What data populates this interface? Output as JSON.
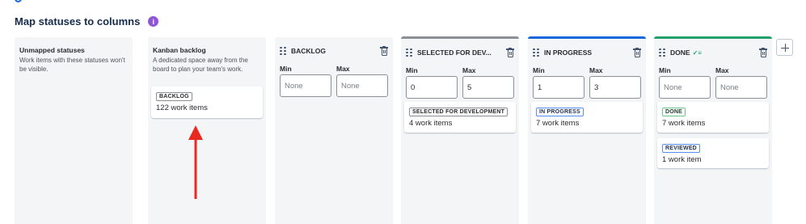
{
  "heading": {
    "title": "Map statuses to columns",
    "info_icon_glyph": "i"
  },
  "unmapped": {
    "title": "Unmapped statuses",
    "description": "Work items with these statuses won't be visible."
  },
  "kanban_backlog": {
    "title": "Kanban backlog",
    "description": "A dedicated space away from the board to plan your team's work.",
    "card": {
      "status": "BACKLOG",
      "count": "122 work items"
    }
  },
  "columns": [
    {
      "name": "BACKLOG",
      "min_label": "Min",
      "max_label": "Max",
      "min_value": "",
      "max_value": "",
      "min_placeholder": "None",
      "max_placeholder": "None",
      "cards": []
    },
    {
      "name": "SELECTED FOR DEV...",
      "accent": "#8c8f97",
      "min_label": "Min",
      "max_label": "Max",
      "min_value": "0",
      "max_value": "5",
      "min_placeholder": "None",
      "max_placeholder": "None",
      "cards": [
        {
          "status": "SELECTED FOR DEVELOPMENT",
          "count": "4 work items"
        }
      ]
    },
    {
      "name": "IN PROGRESS",
      "accent": "#1868db",
      "min_label": "Min",
      "max_label": "Max",
      "min_value": "1",
      "max_value": "3",
      "min_placeholder": "None",
      "max_placeholder": "None",
      "cards": [
        {
          "status": "IN PROGRESS",
          "count": "7 work items"
        }
      ]
    },
    {
      "name": "DONE",
      "accent": "#22a06b",
      "done_icon": "✓≡",
      "min_label": "Min",
      "max_label": "Max",
      "min_value": "",
      "max_value": "",
      "min_placeholder": "None",
      "max_placeholder": "None",
      "cards": [
        {
          "status": "DONE",
          "count": "7 work items"
        },
        {
          "status": "REVIEWED",
          "count": "1 work item"
        }
      ]
    }
  ],
  "icons": {
    "drag": "drag-handle-icon",
    "delete": "trash-icon",
    "add": "plus-icon",
    "info": "info-icon"
  },
  "colors": {
    "annotation_arrow": "#e8291f",
    "info_icon": "#8f56d9",
    "in_progress_accent": "#1868db",
    "done_accent": "#22a06b"
  }
}
